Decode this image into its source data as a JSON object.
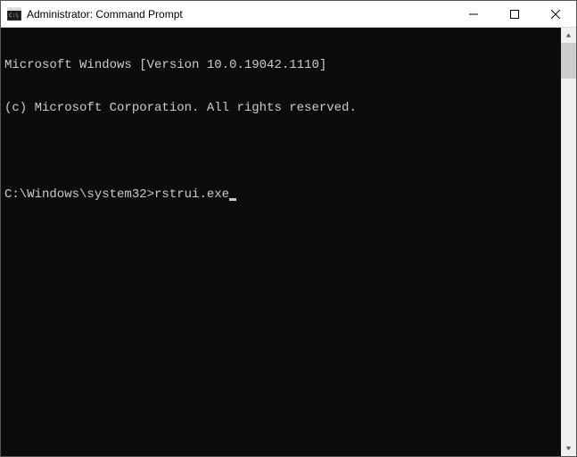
{
  "titlebar": {
    "title": "Administrator: Command Prompt"
  },
  "terminal": {
    "line1": "Microsoft Windows [Version 10.0.19042.1110]",
    "line2": "(c) Microsoft Corporation. All rights reserved.",
    "line3": "",
    "prompt": "C:\\Windows\\system32>",
    "command": "rstrui.exe"
  }
}
